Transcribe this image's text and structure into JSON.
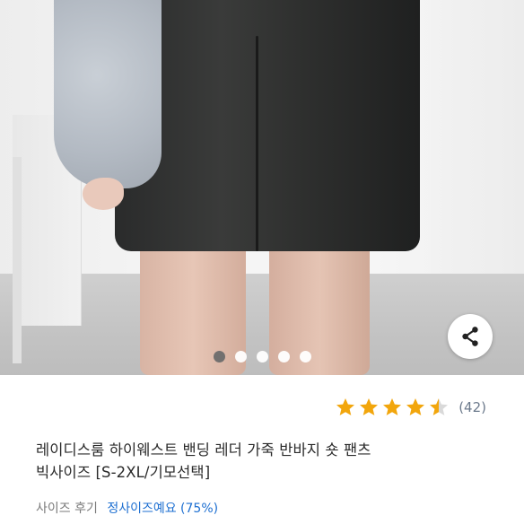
{
  "carousel": {
    "dots": [
      true,
      false,
      false,
      false,
      false
    ]
  },
  "icons": {
    "share": "share-icon",
    "star": "star-icon"
  },
  "colors": {
    "star": "#f2a60c",
    "link": "#1d6fd1"
  },
  "product": {
    "rating": 4.5,
    "review_count": "(42)",
    "title_line1": "레이디스룸 하이웨스트 밴딩 레더 가죽 반바지 숏 팬츠",
    "title_line2": "빅사이즈 [S-2XL/기모선택]"
  },
  "size_review": {
    "label": "사이즈 후기",
    "value": "정사이즈예요",
    "percent": "(75%)"
  }
}
